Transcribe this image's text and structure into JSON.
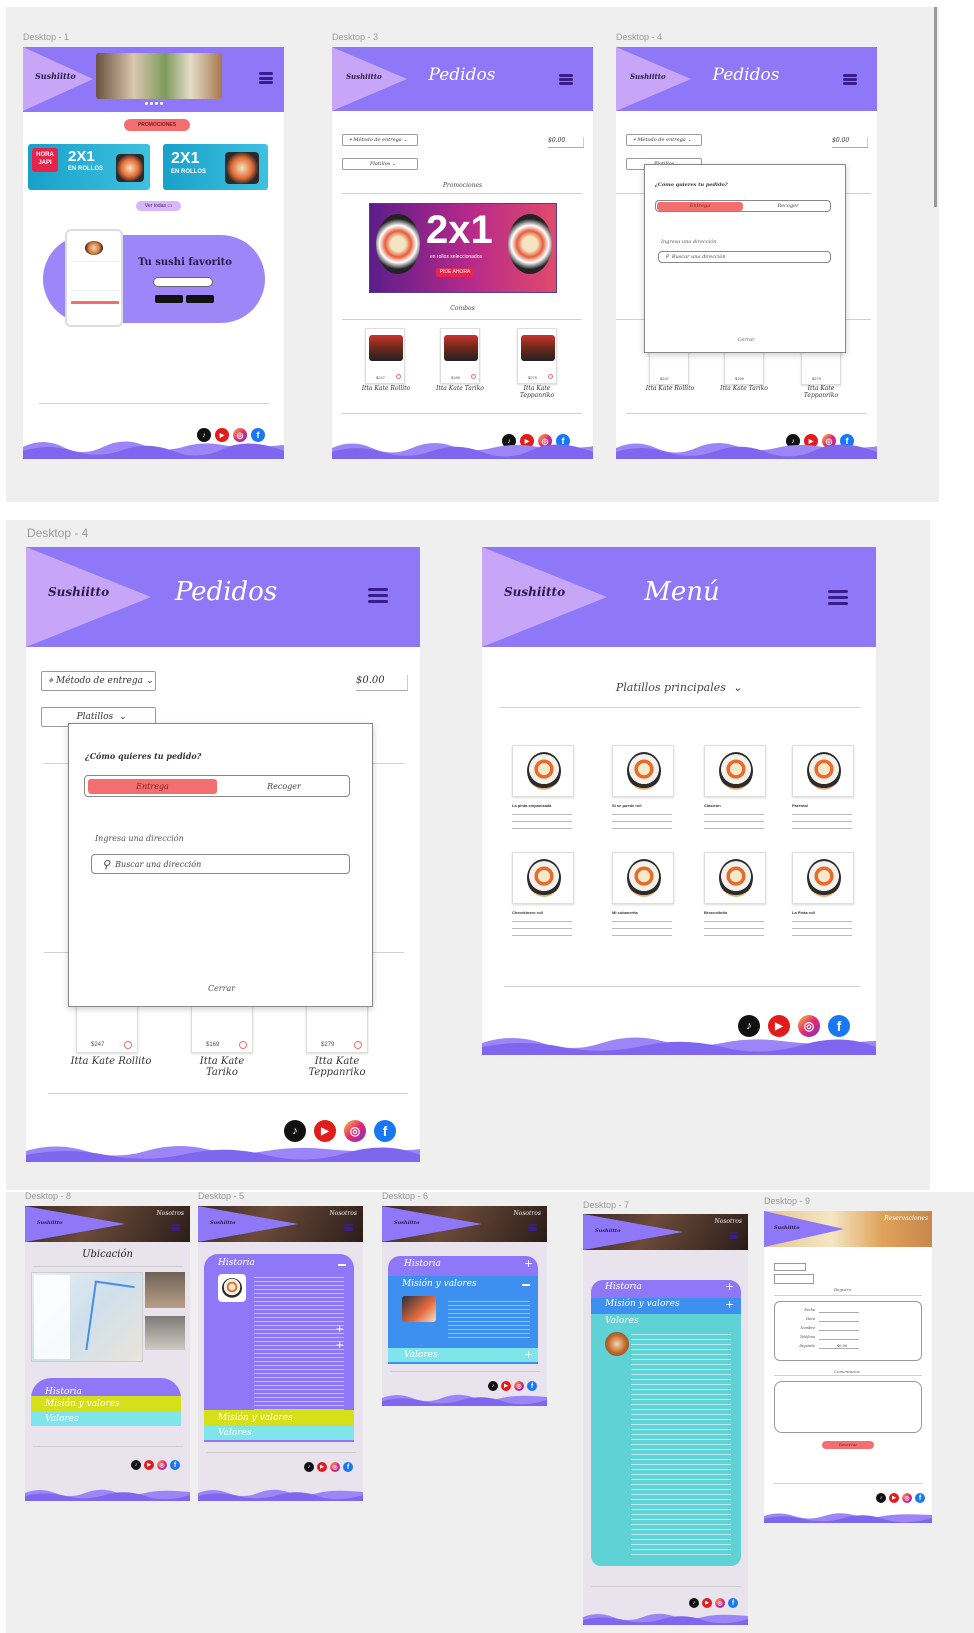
{
  "labels": {
    "d1": "Desktop - 1",
    "d3": "Desktop - 3",
    "d4": "Desktop - 4",
    "d4b": "Desktop - 4",
    "d8": "Desktop - 8",
    "d5": "Desktop - 5",
    "d6": "Desktop - 6",
    "d7": "Desktop - 7",
    "d9": "Desktop - 9"
  },
  "brand": "Sushiitto",
  "home": {
    "promos_button": "PROMOCIONES",
    "see_all": "Ver todas",
    "hero_title": "Tu sushi  favorito",
    "promo_big": "2X1",
    "promo_sub": "EN ROLLOS",
    "promo_tag": "HORA JAPI"
  },
  "pedidos": {
    "title": "Pedidos",
    "delivery_method": "Método de entrega",
    "price": "$0.00",
    "category": "Platillos",
    "promos_heading": "Promociones",
    "promo_banner": "2x1",
    "promo_banner_sub": "en rollos seleccionados",
    "promo_banner_cta": "PIDE AHORA",
    "combos_heading": "Combos",
    "products": [
      {
        "name": "Itta Kate Rollito",
        "price": "$247"
      },
      {
        "name": "Itta Kate Tariko",
        "price": "$169"
      },
      {
        "name": "Itta Kate Teppanriko",
        "price": "$279"
      }
    ],
    "modal": {
      "question": "¿Cómo quieres tu pedido?",
      "opt_delivery": "Entrega",
      "opt_pickup": "Recoger",
      "address_label": "Ingresa una dirección",
      "search_placeholder": "Buscar una dirección",
      "close": "Cerrar"
    }
  },
  "menu": {
    "title": "Menú",
    "category": "Platillos principales",
    "items": [
      {
        "name": "La pinta empanizada"
      },
      {
        "name": "Sí se puede roll"
      },
      {
        "name": "Clasicón"
      },
      {
        "name": "Parental"
      },
      {
        "name": "Cherokinero roll"
      },
      {
        "name": "Mi cubanerita"
      },
      {
        "name": "Broccolinito"
      },
      {
        "name": "La Pinta roll"
      }
    ]
  },
  "nosotros": {
    "hero_label": "Nosotros",
    "ubicacion": "Ubicación",
    "historia": "Historia",
    "mision": "Misión y valores",
    "valores": "Valores",
    "colors": {
      "historia": "#8e78f7",
      "mision": "#d6e01a",
      "valores": "#7ee6ea",
      "teal": "#5fd2d6",
      "blue": "#3d8ff0"
    }
  },
  "reservas": {
    "hero_label": "Reservaciones",
    "register": "Registro",
    "comments": "Comentarios",
    "button": "Reservar",
    "fields": [
      "Fecha",
      "Hora",
      "Nombre",
      "Teléfono",
      "Depósito"
    ],
    "deposit": "$0.00"
  },
  "social": {
    "tiktok": "♪",
    "youtube": "▶",
    "instagram": "◎",
    "facebook": "f"
  },
  "colors": {
    "primary": "#8e78f7",
    "accent": "#f36f6f",
    "lavender": "#c8a6f7"
  }
}
